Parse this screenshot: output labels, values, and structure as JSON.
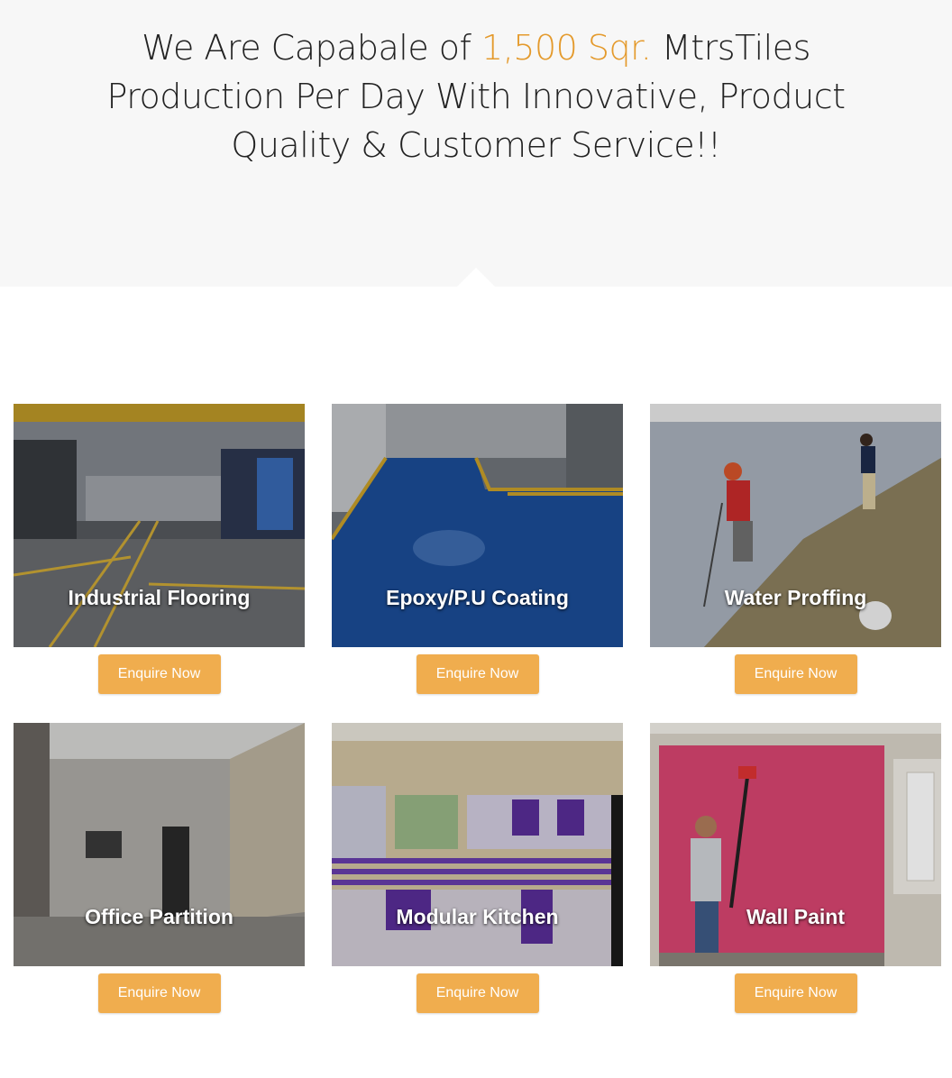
{
  "hero": {
    "line1_pre": "We Are Capabale of ",
    "line1_accent": "1,500 Sqr.",
    "line1_post": " MtrsTiles",
    "line2": "Production Per Day With Innovative, Product",
    "line3": "Quality & Customer Service!!"
  },
  "colors": {
    "accent": "#e49a2c",
    "button": "#f0ad4e",
    "hero_bg": "#f7f7f7"
  },
  "services": [
    {
      "title": "Industrial Flooring",
      "button": "Enquire Now"
    },
    {
      "title": "Epoxy/P.U Coating",
      "button": "Enquire Now"
    },
    {
      "title": "Water Proffing",
      "button": "Enquire Now"
    },
    {
      "title": "Office Partition",
      "button": "Enquire Now"
    },
    {
      "title": "Modular Kitchen",
      "button": "Enquire Now"
    },
    {
      "title": "Wall Paint",
      "button": "Enquire Now"
    }
  ]
}
